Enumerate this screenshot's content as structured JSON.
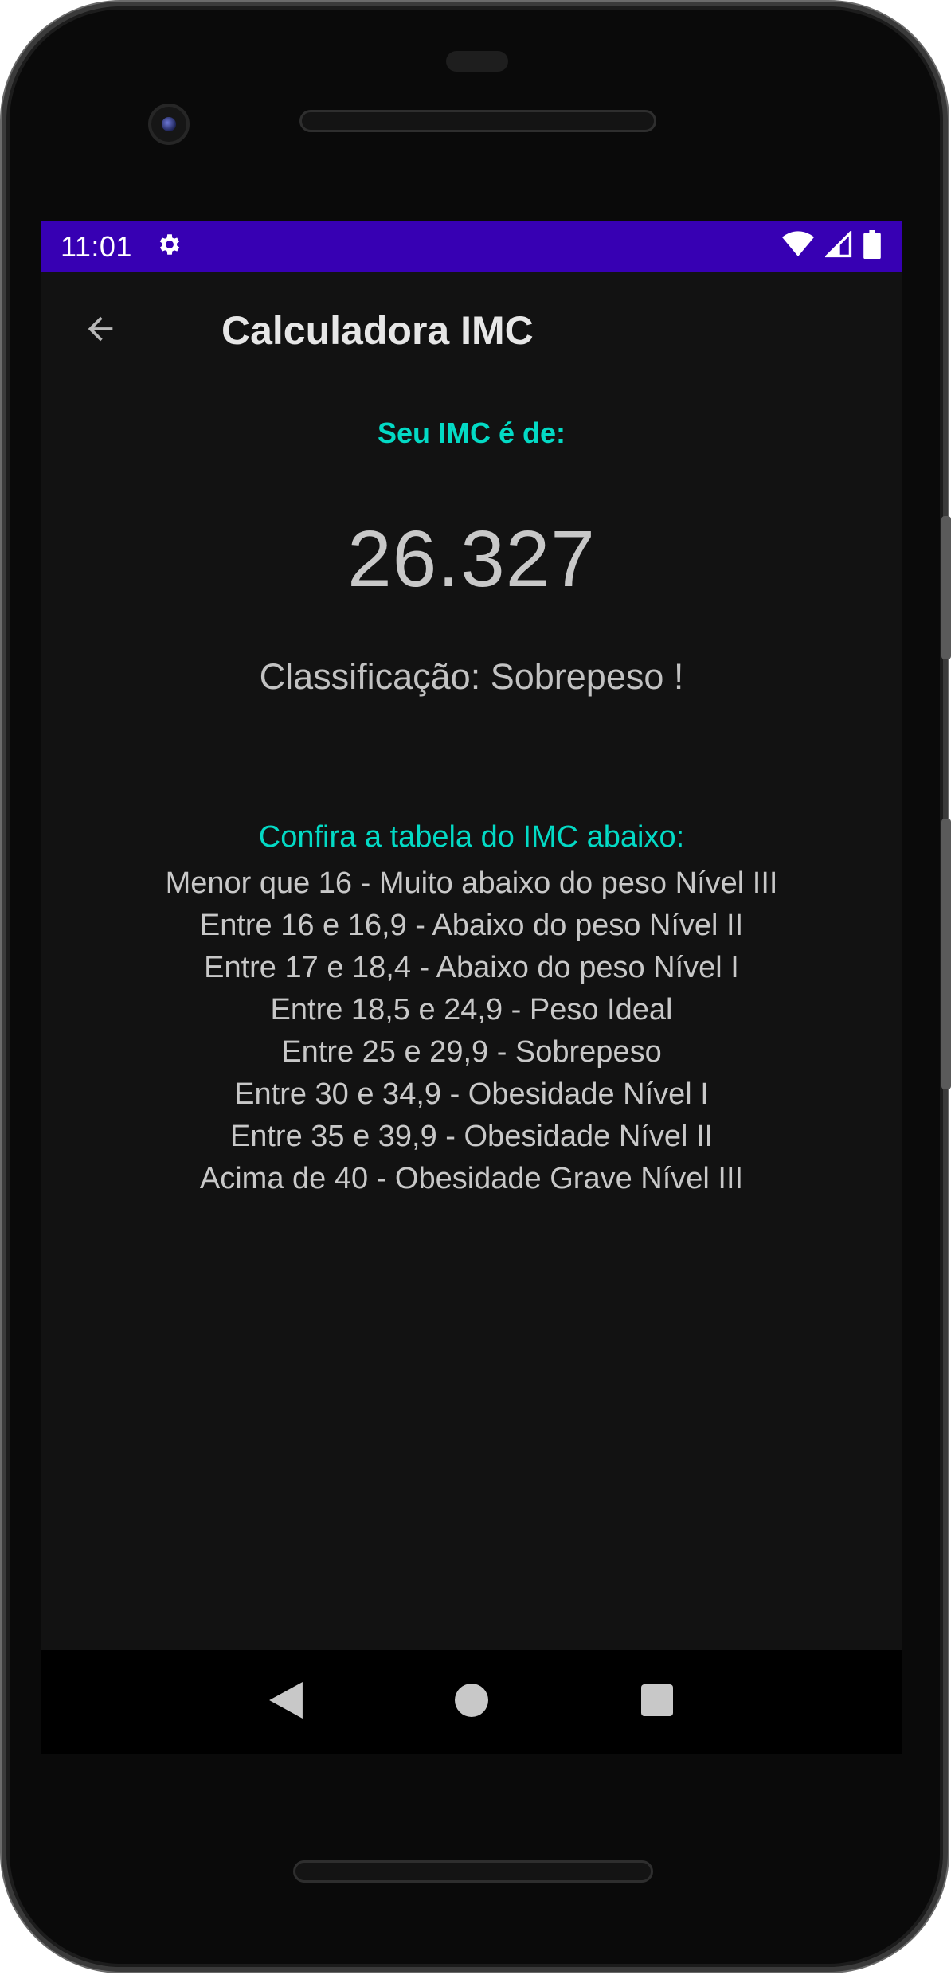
{
  "status_bar": {
    "time": "11:01",
    "background_color": "#3700b3",
    "icons": [
      "gear-icon",
      "wifi-icon",
      "signal-icon",
      "battery-icon"
    ]
  },
  "app_bar": {
    "title": "Calculadora IMC",
    "back_icon": "arrow-left-icon"
  },
  "result": {
    "label": "Seu IMC é de:",
    "value": "26.327",
    "classification": "Classificação: Sobrepeso !"
  },
  "table": {
    "title": "Confira a tabela do IMC abaixo:",
    "rows": [
      "Menor que 16 - Muito abaixo do peso Nível III",
      "Entre 16 e 16,9 - Abaixo do peso Nível II",
      "Entre 17 e 18,4 - Abaixo do peso Nível I",
      "Entre 18,5 e 24,9 - Peso Ideal",
      "Entre 25 e 29,9 - Sobrepeso",
      "Entre 30 e 34,9 - Obesidade Nível I",
      "Entre 35 e 39,9 - Obesidade Nível II",
      "Acima de 40 - Obesidade Grave Nível III"
    ]
  },
  "nav_bar": {
    "buttons": [
      "back-triangle-icon",
      "home-circle-icon",
      "recents-square-icon"
    ]
  },
  "colors": {
    "accent": "#03dac5",
    "screen_background": "#121212",
    "text": "#c8c8c8"
  }
}
